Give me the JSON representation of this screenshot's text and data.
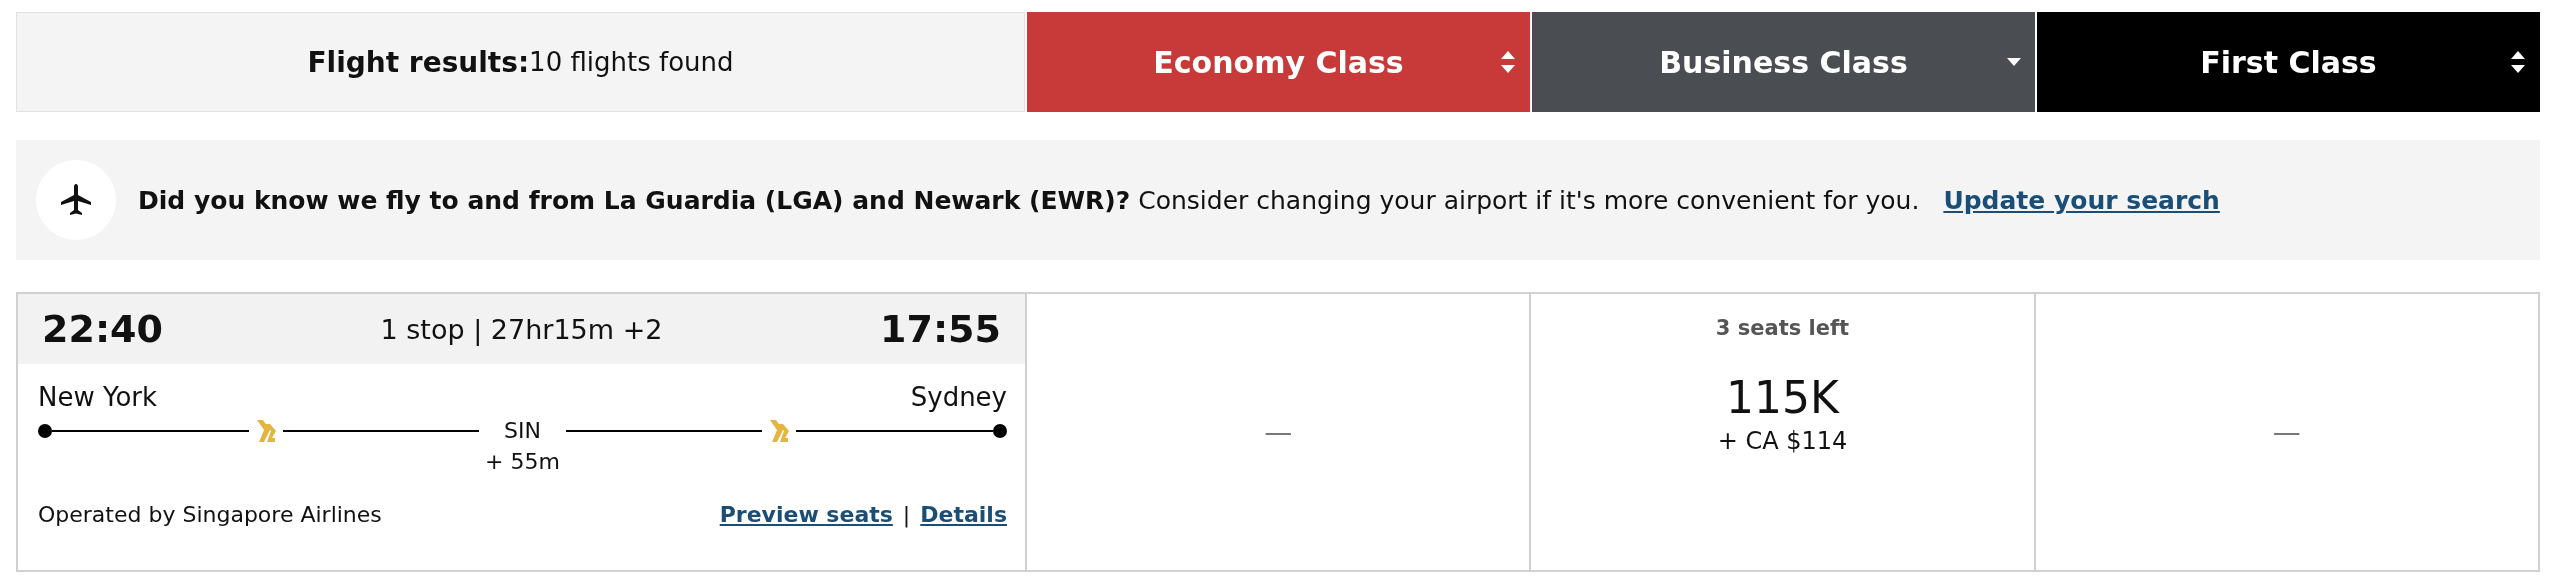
{
  "results_header": {
    "label": "Flight results:",
    "count": "10 flights found"
  },
  "class_tabs": [
    {
      "label": "Economy Class",
      "color": "#c83a3a",
      "kind": "sort"
    },
    {
      "label": "Business Class",
      "color": "#4a4d52",
      "kind": "dropdown"
    },
    {
      "label": "First Class",
      "color": "#000000",
      "kind": "sort"
    }
  ],
  "notice": {
    "message": "**Did you know we fly to and from La Guardia (LGA) and Newark (EWR)?** Consider changing your airport if it's more convenient for you.",
    "link": "Update your search"
  },
  "flight": {
    "depart_time": "22:40",
    "summary": "1 stop | 27hr15m +2",
    "arrive_time": "17:55",
    "origin": "New York",
    "destination": "Sydney",
    "stop": "SIN",
    "layover": "+ 55m",
    "operator": "Operated by Singapore Airlines",
    "links": [
      "Preview seats",
      "Details"
    ],
    "separator": "|",
    "fares": [
      {
        "kind": "unavailable",
        "text": "—"
      },
      {
        "kind": "available",
        "seats": "3 seats left",
        "miles": "115K",
        "cash": "+ CA $114"
      },
      {
        "kind": "unavailable",
        "text": "—"
      }
    ]
  }
}
